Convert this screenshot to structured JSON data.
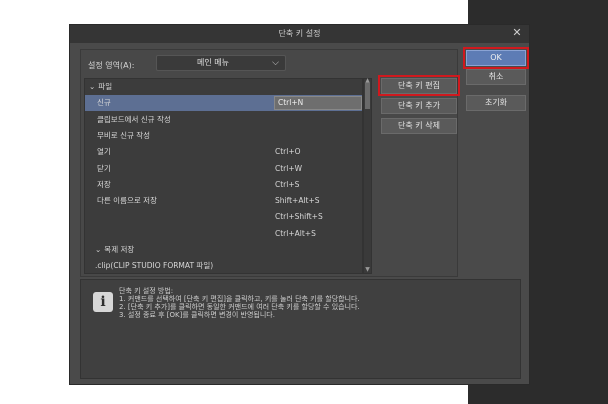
{
  "dialog": {
    "title": "단축 키 설정",
    "close_glyph": "✕"
  },
  "area": {
    "label": "설정 영역(A):",
    "selected": "메인 메뉴"
  },
  "shortcut_list": [
    {
      "type": "group",
      "command": "파일",
      "key": ""
    },
    {
      "type": "item",
      "command": "신규",
      "key": "Ctrl+N",
      "selected": true
    },
    {
      "type": "item",
      "command": "클립보드에서 신규 작성",
      "key": ""
    },
    {
      "type": "item",
      "command": "무비로 신규 작성",
      "key": ""
    },
    {
      "type": "item",
      "command": "열기",
      "key": "Ctrl+O"
    },
    {
      "type": "item",
      "command": "닫기",
      "key": "Ctrl+W"
    },
    {
      "type": "item",
      "command": "저장",
      "key": "Ctrl+S"
    },
    {
      "type": "item",
      "command": "다른 이름으로 저장",
      "key": "Shift+Alt+S"
    },
    {
      "type": "item",
      "command": "",
      "key": "Ctrl+Shift+S"
    },
    {
      "type": "item",
      "command": "",
      "key": "Ctrl+Alt+S"
    },
    {
      "type": "subgroup",
      "command": "복제 저장",
      "key": ""
    },
    {
      "type": "subitem",
      "command": ".clip(CLIP STUDIO FORMAT 파일)",
      "key": ""
    }
  ],
  "buttons": {
    "edit_shortcut": "단축 키 편집",
    "add_shortcut": "단축 키 추가",
    "delete_shortcut": "단축 키 삭제",
    "ok": "OK",
    "cancel": "취소",
    "reset": "초기화"
  },
  "info": {
    "title": "단축 키 설정 방법:",
    "lines": [
      "1. 커맨드를 선택하여 [단축 키 편집]을 클릭하고, 키를 눌러 단축 키를 할당합니다.",
      "2. [단축 키 추가]를 클릭하면 동일한 커맨드에 여러 단축 키를 할당할 수 있습니다.",
      "3. 설정 종료 후 [OK]를 클릭하면 변경이 반영됩니다."
    ]
  },
  "icons": {
    "info_glyph": "i",
    "chevron_down": "⌵",
    "group_toggle": "⌄",
    "scroll_up": "▲",
    "scroll_down": "▼"
  },
  "colors": {
    "highlight_border": "#d0191e",
    "selection": "#5d6f93",
    "ok_button": "#5d7cb5"
  }
}
